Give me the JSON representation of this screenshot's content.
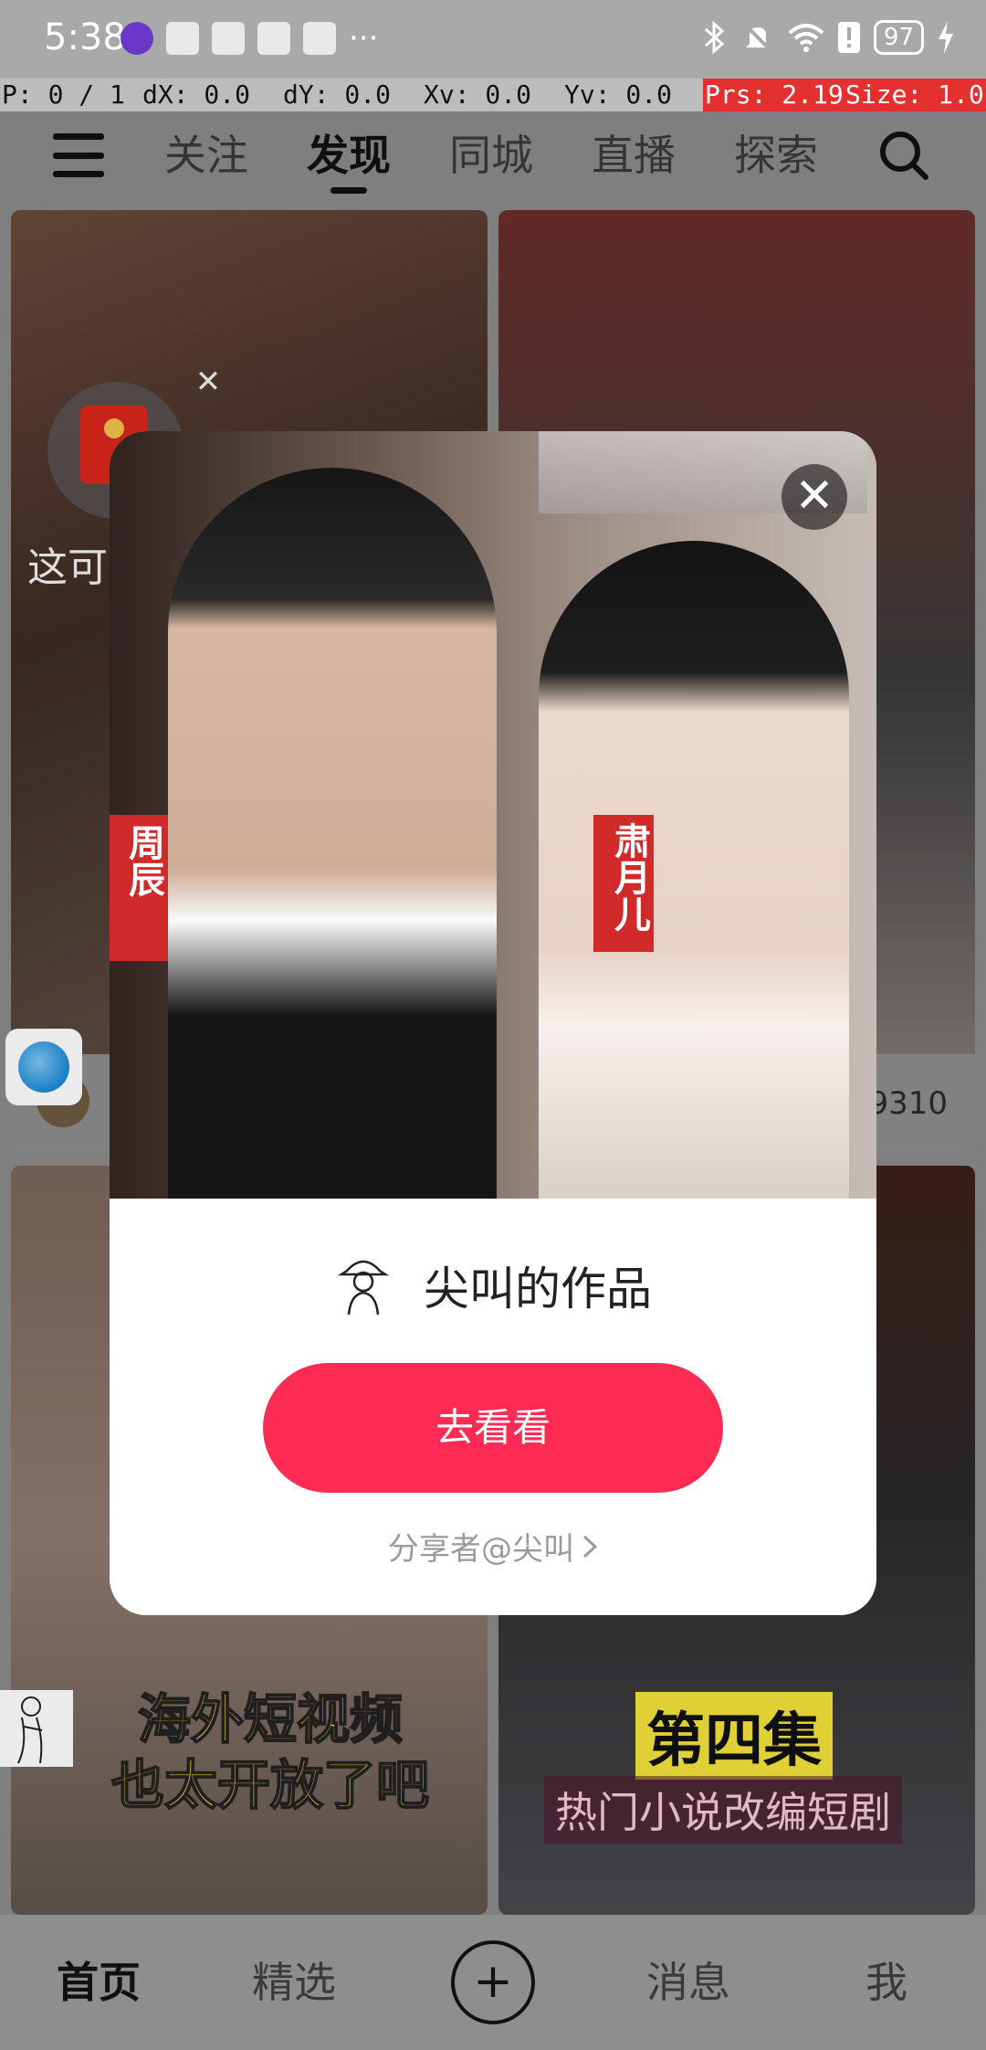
{
  "status_bar": {
    "time": "5:38",
    "battery": "97",
    "more": "···"
  },
  "pointer_overlay": {
    "p": "P: 0 / 1",
    "dx": "dX: 0.0",
    "dy": "dY: 0.0",
    "xv": "Xv: 0.0",
    "yv": "Yv: 0.0",
    "prs": "Prs: 2.19",
    "size": "Size: 1.0"
  },
  "top_nav": {
    "tabs": [
      "关注",
      "发现",
      "同城",
      "直播",
      "探索"
    ],
    "active_tab": "发现"
  },
  "feed": {
    "card1_partial_text": "这可",
    "card2_count": "9310",
    "card3_caption": "海外短视频\n也太开放了吧",
    "card4_caption_title": "第四集",
    "card4_caption_sub": "热门小说改编短剧"
  },
  "modal": {
    "poster_label_1": "周辰",
    "poster_label_2": "肃月儿",
    "title": "尖叫的作品",
    "button_label": "去看看",
    "sharer": "分享者@尖叫",
    "close_symbol": "✕"
  },
  "bottom_nav": {
    "items": [
      "首页",
      "精选",
      "消息",
      "我"
    ],
    "plus": "+"
  },
  "colors": {
    "accent": "#fe2c55",
    "overlay_red": "#e53030"
  },
  "icons": [
    "menu-icon",
    "search-icon",
    "red-packet-icon",
    "close-icon",
    "plus-icon",
    "chevron-right-icon"
  ]
}
